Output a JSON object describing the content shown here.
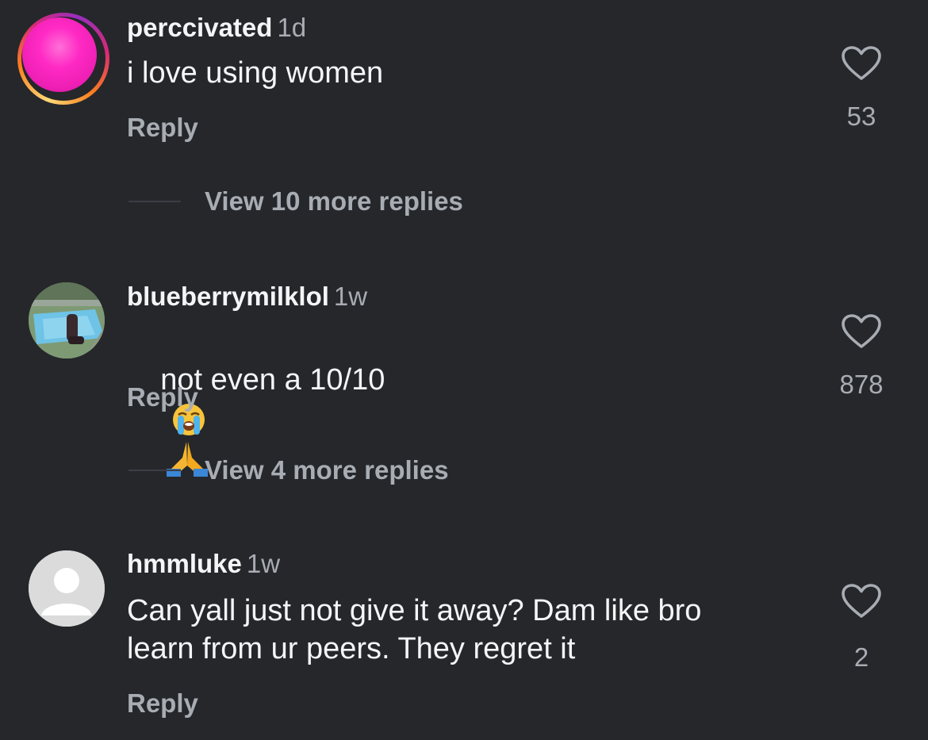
{
  "comments": [
    {
      "username": "perccivated",
      "time": "1d",
      "text": "i love using women",
      "reply_label": "Reply",
      "likes": "53",
      "view_more": "View 10 more replies",
      "avatar": "pink-avatar-with-story-ring"
    },
    {
      "username": "blueberrymilklol",
      "time": "1w",
      "text": "not even a 10/10",
      "emojis": [
        "loudly-crying-face-emoji",
        "folded-hands-emoji"
      ],
      "reply_label": "Reply",
      "likes": "878",
      "view_more": "View 4 more replies",
      "avatar": "photo-avatar"
    },
    {
      "username": "hmmluke",
      "time": "1w",
      "text": "Can yall just not give it away? Dam like bro\nlearn from ur peers. They regret it",
      "reply_label": "Reply",
      "likes": "2",
      "avatar": "default-avatar"
    }
  ],
  "icons": {
    "like": "heart-icon"
  },
  "colors": {
    "background": "#25272b",
    "primary_text": "#f3f5f7",
    "secondary_text": "#a8acb3"
  }
}
